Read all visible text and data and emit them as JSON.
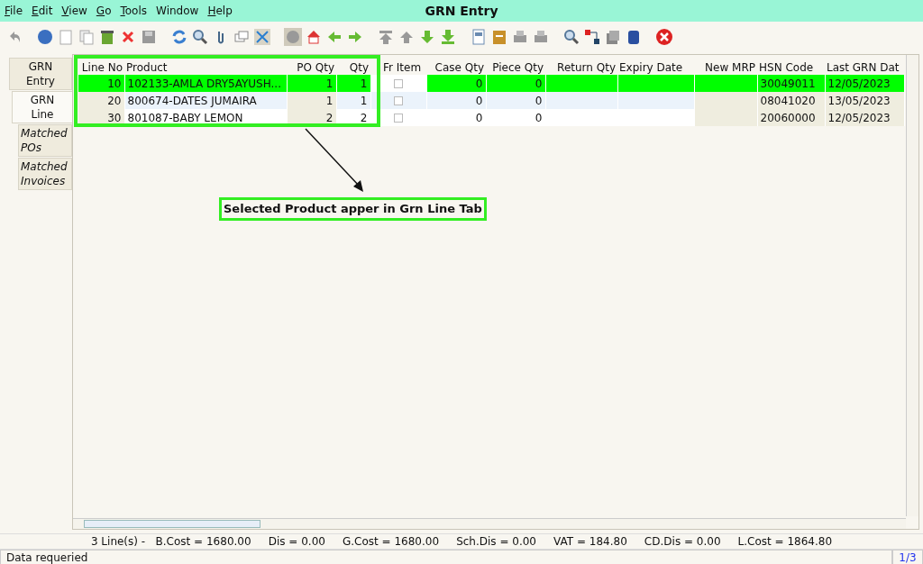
{
  "window": {
    "title": "GRN Entry"
  },
  "menu": [
    {
      "label": "File",
      "mnemonic": true
    },
    {
      "label": "Edit",
      "mnemonic": true
    },
    {
      "label": "View",
      "mnemonic": true
    },
    {
      "label": "Go",
      "mnemonic": true
    },
    {
      "label": "Tools",
      "mnemonic": true
    },
    {
      "label": "Window",
      "mnemonic": false
    },
    {
      "label": "Help",
      "mnemonic": true
    }
  ],
  "tabs": [
    {
      "label": "GRN Entry",
      "kind": "main",
      "selected": false
    },
    {
      "label": "GRN Line",
      "kind": "main",
      "selected": true
    },
    {
      "label": "Matched POs",
      "kind": "child",
      "selected": false
    },
    {
      "label": "Matched Invoices",
      "kind": "child",
      "selected": false
    }
  ],
  "table": {
    "columns": [
      {
        "label": "Line No",
        "readonly": true,
        "kind": "number"
      },
      {
        "label": "Product",
        "readonly": false,
        "kind": "text"
      },
      {
        "label": "PO Qty",
        "readonly": true,
        "kind": "number"
      },
      {
        "label": "Qty",
        "readonly": false,
        "kind": "number"
      },
      {
        "label": "Fr Item",
        "readonly": false,
        "kind": "check"
      },
      {
        "label": "Case Qty",
        "readonly": false,
        "kind": "number"
      },
      {
        "label": "Piece Qty",
        "readonly": false,
        "kind": "number"
      },
      {
        "label": "Return Qty",
        "readonly": false,
        "kind": "number"
      },
      {
        "label": "Expiry Date",
        "readonly": false,
        "kind": "text"
      },
      {
        "label": "New MRP",
        "readonly": true,
        "kind": "number"
      },
      {
        "label": "HSN Code",
        "readonly": true,
        "kind": "text"
      },
      {
        "label": "Last GRN Dat",
        "readonly": true,
        "kind": "text"
      }
    ],
    "rows": [
      {
        "selected": true,
        "cells": [
          "10",
          "102133-AMLA DRY5AYUSH...",
          "1",
          "1",
          false,
          "0",
          "0",
          "",
          "",
          "",
          "30049011",
          "12/05/2023"
        ]
      },
      {
        "selected": false,
        "cells": [
          "20",
          "800674-DATES JUMAIRA",
          "1",
          "1",
          false,
          "0",
          "0",
          "",
          "",
          "",
          "08041020",
          "13/05/2023"
        ]
      },
      {
        "selected": false,
        "cells": [
          "30",
          "801087-BABY LEMON",
          "2",
          "2",
          false,
          "0",
          "0",
          "",
          "",
          "",
          "20060000",
          "12/05/2023"
        ]
      }
    ]
  },
  "annotation": {
    "text": "Selected Product apper in Grn Line Tab"
  },
  "summary": "3 Line(s) -   B.Cost = 1680.00     Dis = 0.00     G.Cost = 1680.00     Sch.Dis = 0.00     VAT = 184.80     CD.Dis = 0.00     L.Cost = 1864.80",
  "status_bar": {
    "message": "Data requeried",
    "page": "1/3"
  }
}
